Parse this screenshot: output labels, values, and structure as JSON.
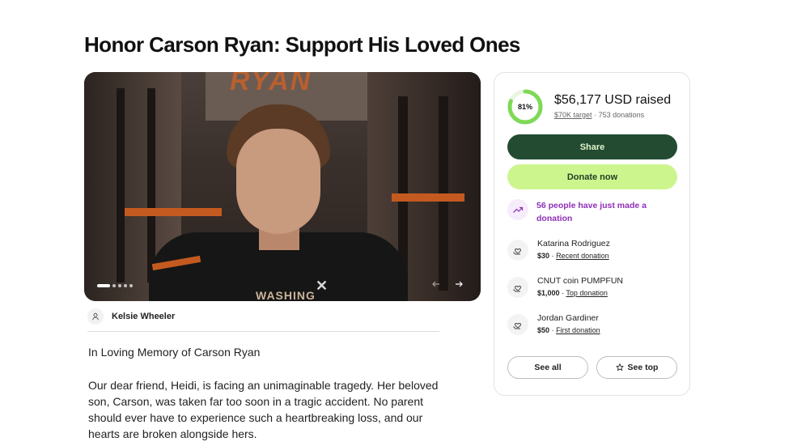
{
  "page": {
    "title": "Honor Carson Ryan: Support His Loved Ones"
  },
  "hero": {
    "banner_text": "RYAN",
    "jersey_text": "WASHING",
    "slide_count": 5,
    "active_slide": 1
  },
  "organizer": {
    "name": "Kelsie Wheeler"
  },
  "story": {
    "heading": "In Loving Memory of Carson Ryan",
    "paragraph": "Our dear friend, Heidi, is facing an unimaginable tragedy. Her beloved son, Carson, was taken far too soon in a tragic accident. No parent should ever have to experience such a heartbreaking loss, and our hearts are broken alongside hers."
  },
  "donation_card": {
    "progress_percent": 81,
    "progress_label": "81%",
    "raised": "$56,177 USD raised",
    "target": "$70K target",
    "separator": "·",
    "donation_count": "753 donations",
    "share_label": "Share",
    "donate_label": "Donate now",
    "trend_text": "56 people have just made a donation",
    "donors": [
      {
        "name": "Katarina Rodriguez",
        "amount": "$30",
        "sep": "·",
        "tag": "Recent donation"
      },
      {
        "name": "CNUT coin PUMPFUN",
        "amount": "$1,000",
        "sep": "·",
        "tag": "Top donation"
      },
      {
        "name": "Jordan Gardiner",
        "amount": "$50",
        "sep": "·",
        "tag": "First donation"
      }
    ],
    "see_all_label": "See all",
    "see_top_label": "See top"
  },
  "colors": {
    "share_bg": "#234b32",
    "donate_bg": "#cdf58e",
    "progress": "#7ed957",
    "trend": "#8e2fb5"
  }
}
